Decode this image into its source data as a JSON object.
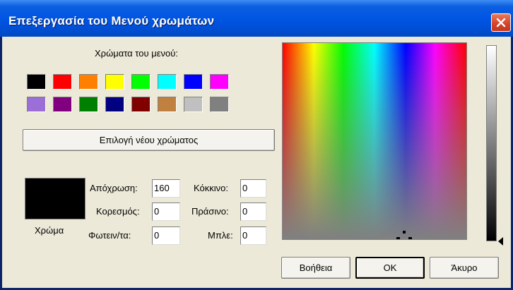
{
  "title": "Επεξεργασία του Μενού χρωμάτων",
  "menu_colors_label": "Χρώματα του μενού:",
  "swatches": [
    "#000000",
    "#ff0000",
    "#ff8000",
    "#ffff00",
    "#00ff00",
    "#00ffff",
    "#0000ff",
    "#ff00ff",
    "#9b6fd7",
    "#800080",
    "#008000",
    "#000080",
    "#800000",
    "#c08040",
    "#c0c0c0",
    "#808080"
  ],
  "select_new_color_label": "Επιλογή νέου χρώματος",
  "preview_color": "#000000",
  "color_label": "Χρώμα",
  "fields": {
    "hue": {
      "label": "Απόχρωση:",
      "value": "160"
    },
    "saturation": {
      "label": "Κορεσμός:",
      "value": "0"
    },
    "luminance": {
      "label": "Φωτειν/τα:",
      "value": "0"
    },
    "red": {
      "label": "Κόκκινο:",
      "value": "0"
    },
    "green": {
      "label": "Πράσινο:",
      "value": "0"
    },
    "blue": {
      "label": "Μπλε:",
      "value": "0"
    }
  },
  "buttons": {
    "help": "Βοήθεια",
    "ok": "OK",
    "cancel": "Άκυρο"
  }
}
